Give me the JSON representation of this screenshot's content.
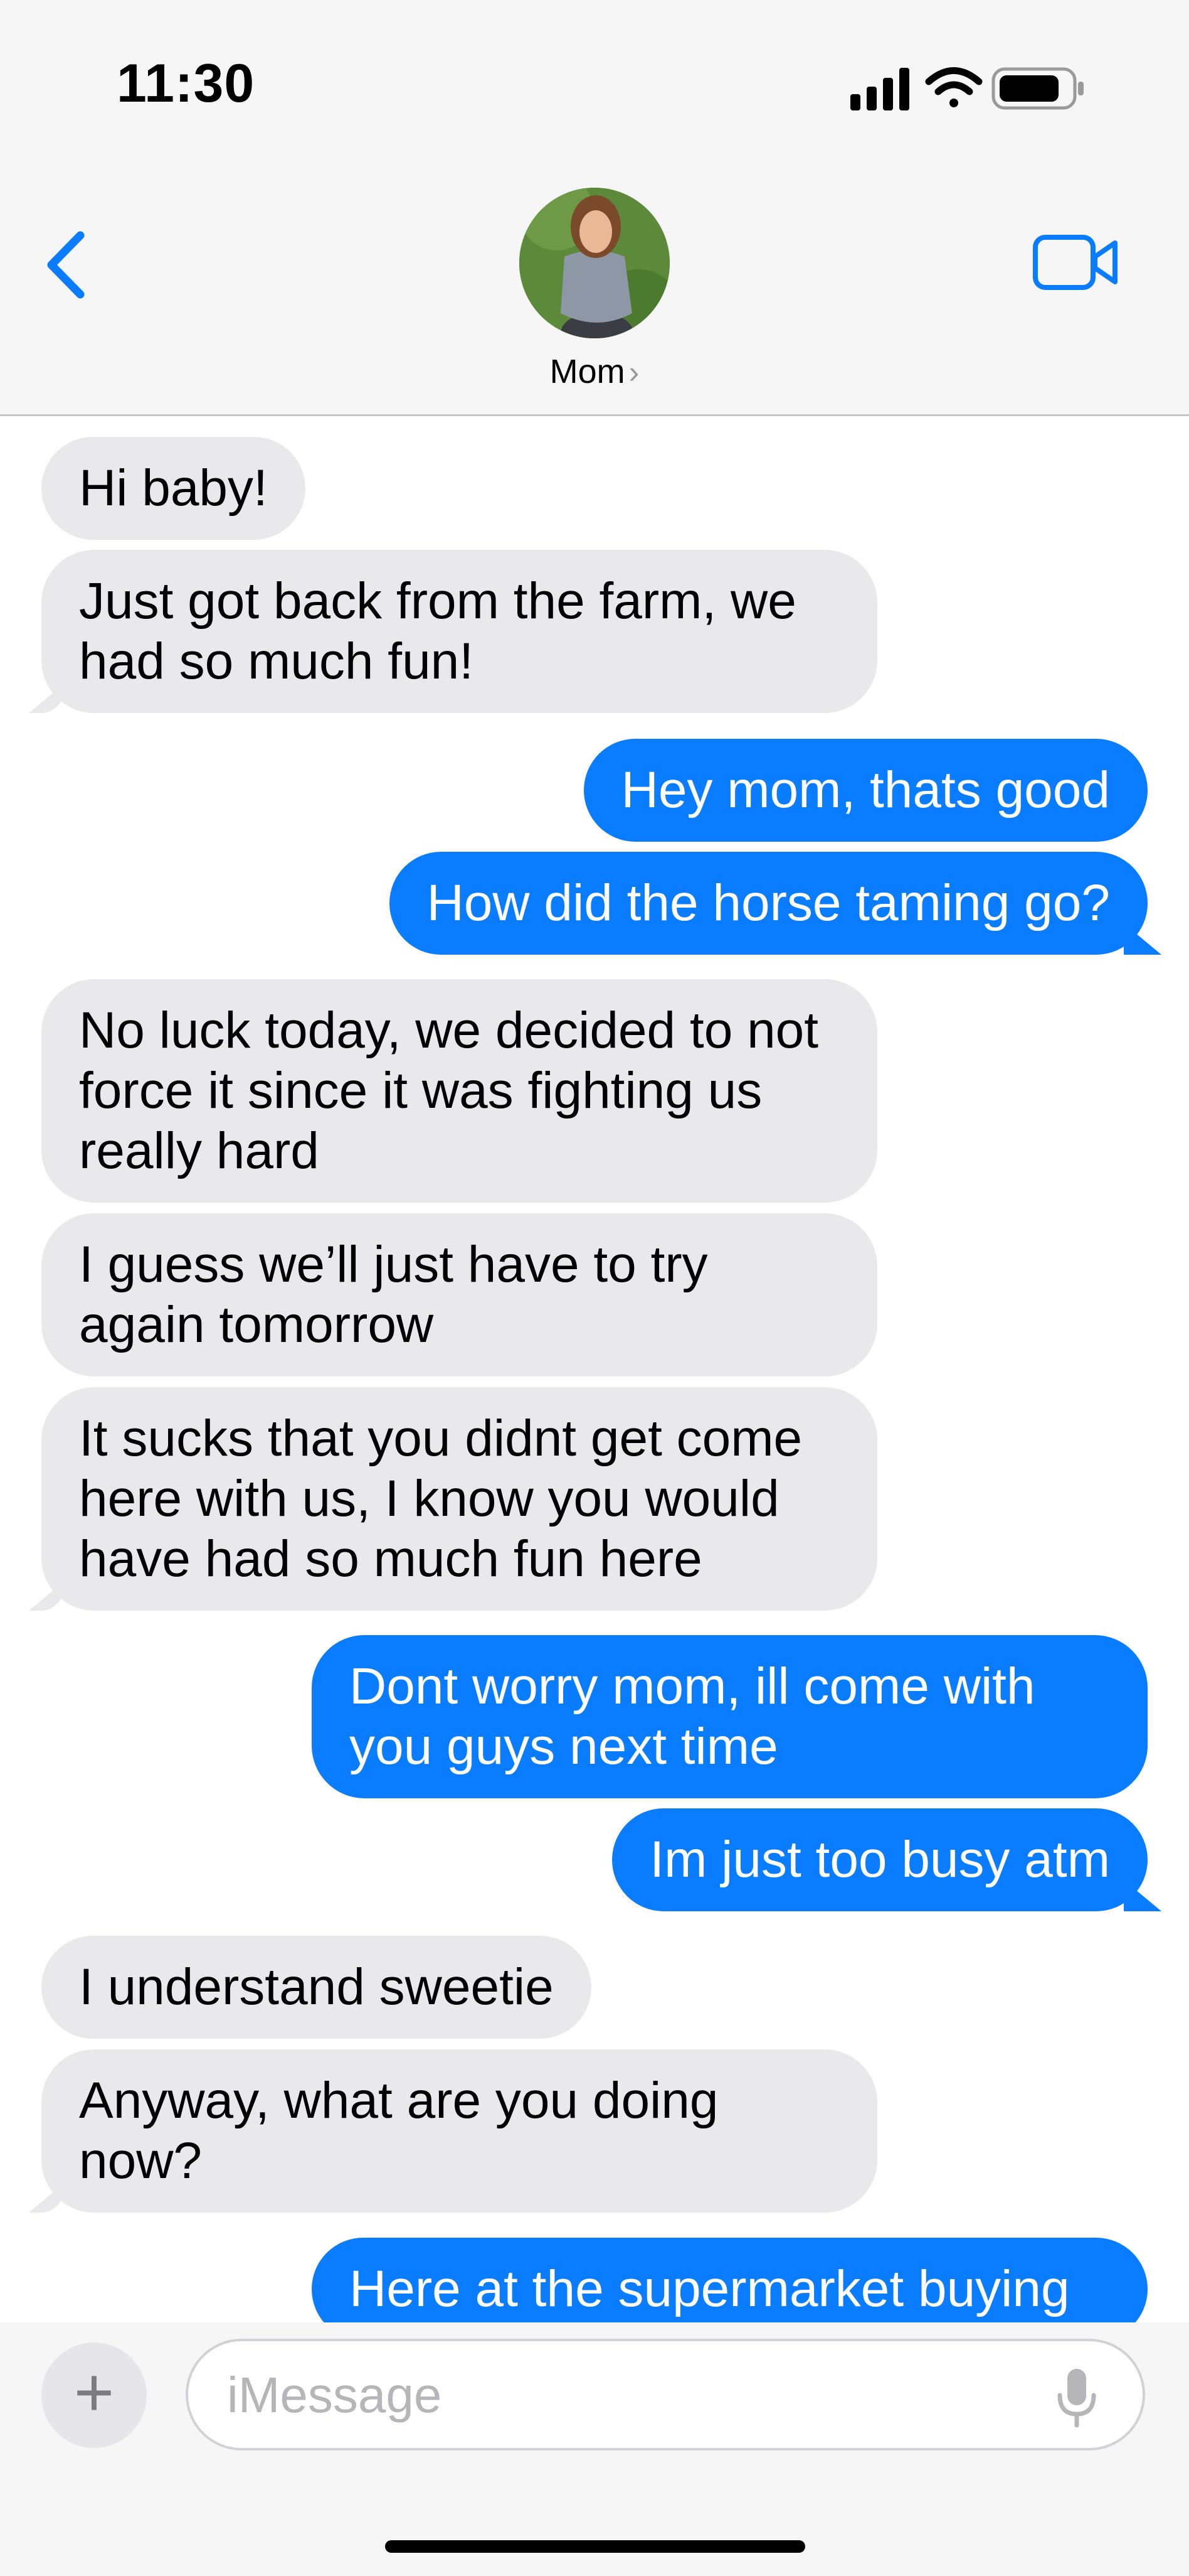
{
  "status_bar": {
    "time": "11:30"
  },
  "header": {
    "contact_name": "Mom",
    "contact_chevron": "›"
  },
  "colors": {
    "incoming": "#e9e9eb",
    "outgoing": "#0a7cff",
    "accent": "#0a7cff"
  },
  "icons": [
    "back-chevron-icon",
    "video-camera-icon",
    "signal-icon",
    "wifi-icon",
    "battery-icon",
    "plus-icon",
    "microphone-icon"
  ],
  "messages": [
    {
      "from": "them",
      "text": "Hi baby!"
    },
    {
      "from": "them",
      "text": "Just got back from the farm, we\nhad so much fun!"
    },
    {
      "from": "me",
      "text": "Hey mom, thats good"
    },
    {
      "from": "me",
      "text": "How did the horse taming go?"
    },
    {
      "from": "them",
      "text": "No luck today, we decided to not\nforce it since it was fighting us\nreally hard"
    },
    {
      "from": "them",
      "text": "I guess we’ll just have to try\nagain tomorrow"
    },
    {
      "from": "them",
      "text": "It sucks that you didnt get come\nhere with us, I know you would\nhave had so much fun here"
    },
    {
      "from": "me",
      "text": "Dont worry mom, ill come with\nyou guys next time"
    },
    {
      "from": "me",
      "text": "Im just too busy atm"
    },
    {
      "from": "them",
      "text": "I understand sweetie"
    },
    {
      "from": "them",
      "text": "Anyway, what are you doing\nnow?"
    },
    {
      "from": "me",
      "text": "Here at the supermarket buying"
    }
  ],
  "composer": {
    "placeholder": "iMessage",
    "value": "",
    "plus_label": "+"
  }
}
